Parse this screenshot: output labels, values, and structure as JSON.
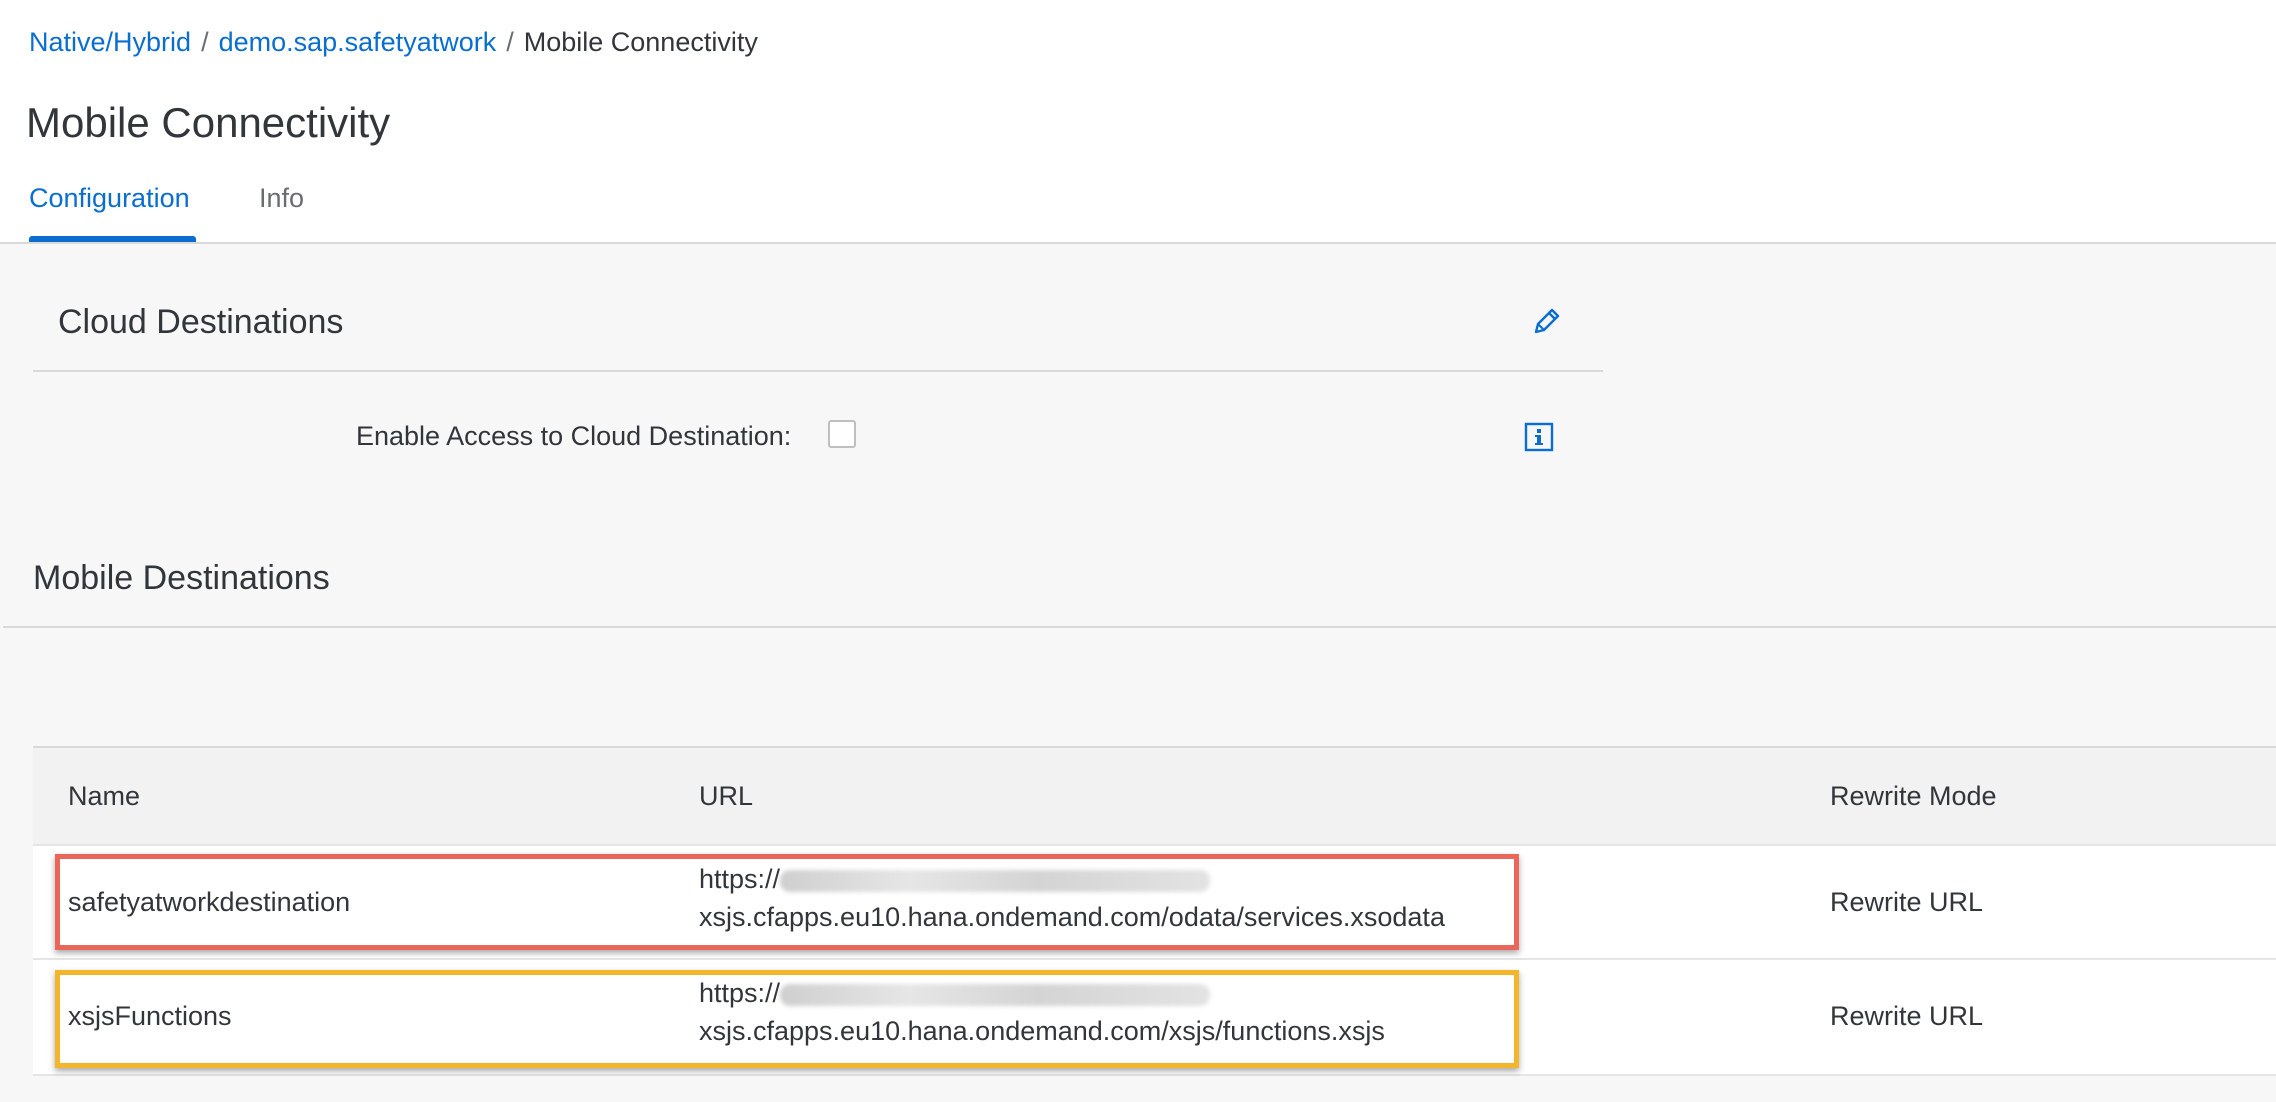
{
  "breadcrumb": {
    "items": [
      "Native/Hybrid",
      "demo.sap.safetyatwork"
    ],
    "current": "Mobile Connectivity",
    "separator": "/"
  },
  "page": {
    "title": "Mobile Connectivity"
  },
  "tabs": [
    {
      "label": "Configuration",
      "active": true
    },
    {
      "label": "Info",
      "active": false
    }
  ],
  "cloud_destinations": {
    "title": "Cloud Destinations",
    "enable_label": "Enable Access to Cloud Destination:",
    "enabled": false,
    "edit_icon": "pencil-icon",
    "info_icon": "info-icon"
  },
  "mobile_destinations": {
    "title": "Mobile Destinations",
    "columns": [
      "Name",
      "URL",
      "Rewrite Mode"
    ],
    "rows": [
      {
        "name": "safetyatworkdestination",
        "url_prefix": "https://",
        "url_suffix": "xsjs.cfapps.eu10.hana.ondemand.com/odata/services.xsodata",
        "rewrite_mode": "Rewrite URL"
      },
      {
        "name": "xsjsFunctions",
        "url_prefix": "https://",
        "url_suffix": "xsjs.cfapps.eu10.hana.ondemand.com/xsjs/functions.xsjs",
        "rewrite_mode": "Rewrite URL"
      }
    ]
  },
  "colors": {
    "link": "#0a6ed1",
    "highlight_row1": "#e8665a",
    "highlight_row2": "#f2b52b"
  }
}
